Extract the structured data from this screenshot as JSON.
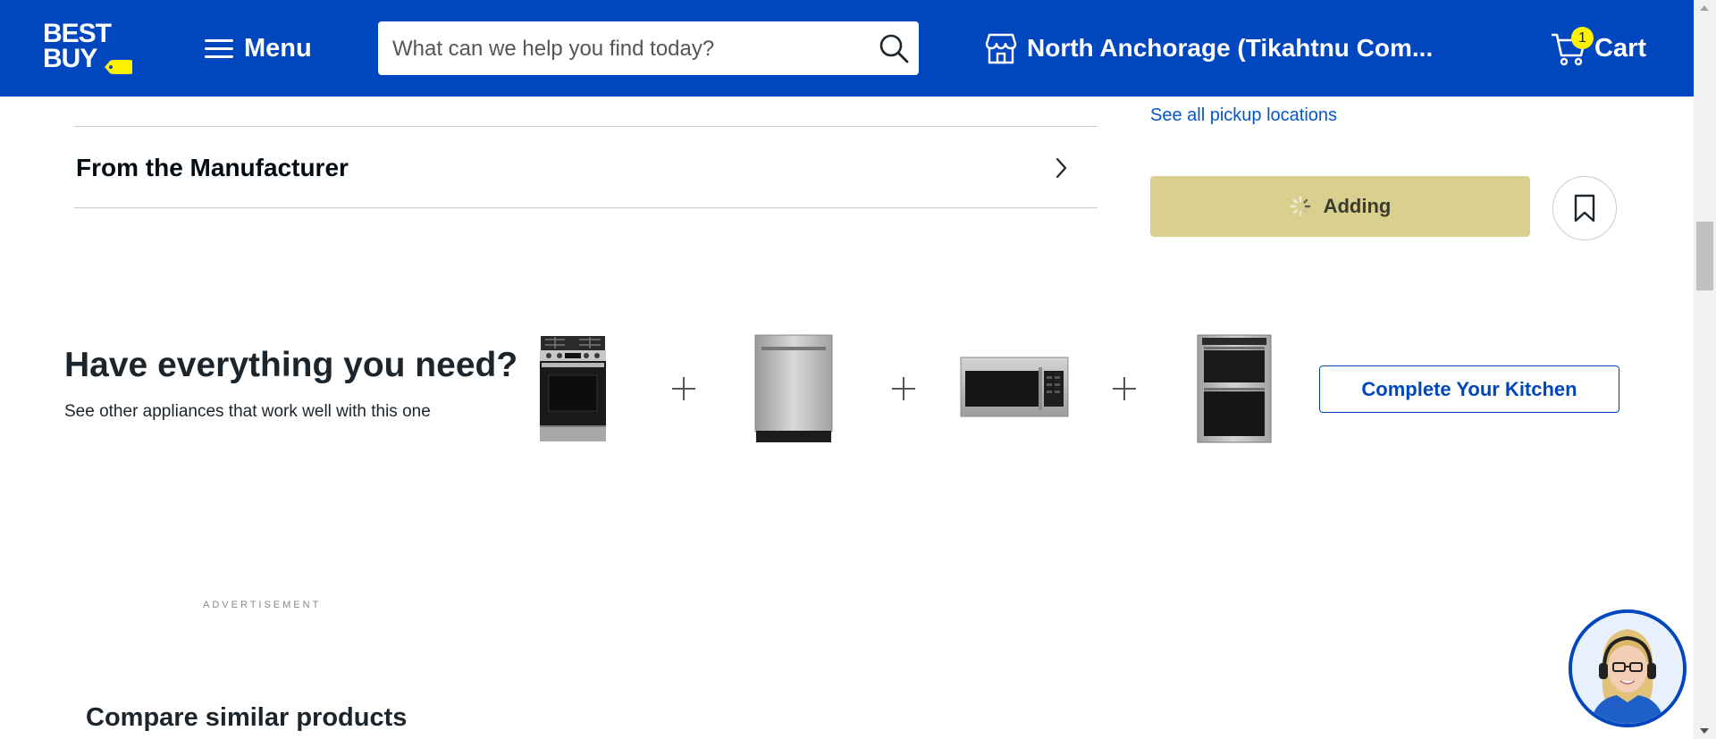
{
  "header": {
    "logo_line1": "BEST",
    "logo_line2": "BUY",
    "menu_label": "Menu",
    "search_placeholder": "What can we help you find today?",
    "store_label": "North Anchorage (Tikahtnu Com...",
    "cart_label": "Cart",
    "cart_count": "1",
    "brand_color": "#0046be",
    "accent_color": "#fff200"
  },
  "details": {
    "accordion_title": "From the Manufacturer"
  },
  "purchase": {
    "pickup_link": "See all pickup locations",
    "add_button_label": "Adding",
    "add_button_state": "loading"
  },
  "promo": {
    "title": "Have everything you need?",
    "subtitle": "See other appliances that work well with this one",
    "appliances": [
      "range-image",
      "dishwasher-image",
      "microwave-image",
      "wall-oven-image"
    ],
    "button_label": "Complete Your Kitchen"
  },
  "ad": {
    "label": "ADVERTISEMENT"
  },
  "compare": {
    "title": "Compare similar products"
  },
  "icons": [
    "hamburger-icon",
    "search-icon",
    "store-icon",
    "cart-icon",
    "chevron-right-icon",
    "loading-spinner-icon",
    "bookmark-icon",
    "plus-icon"
  ]
}
